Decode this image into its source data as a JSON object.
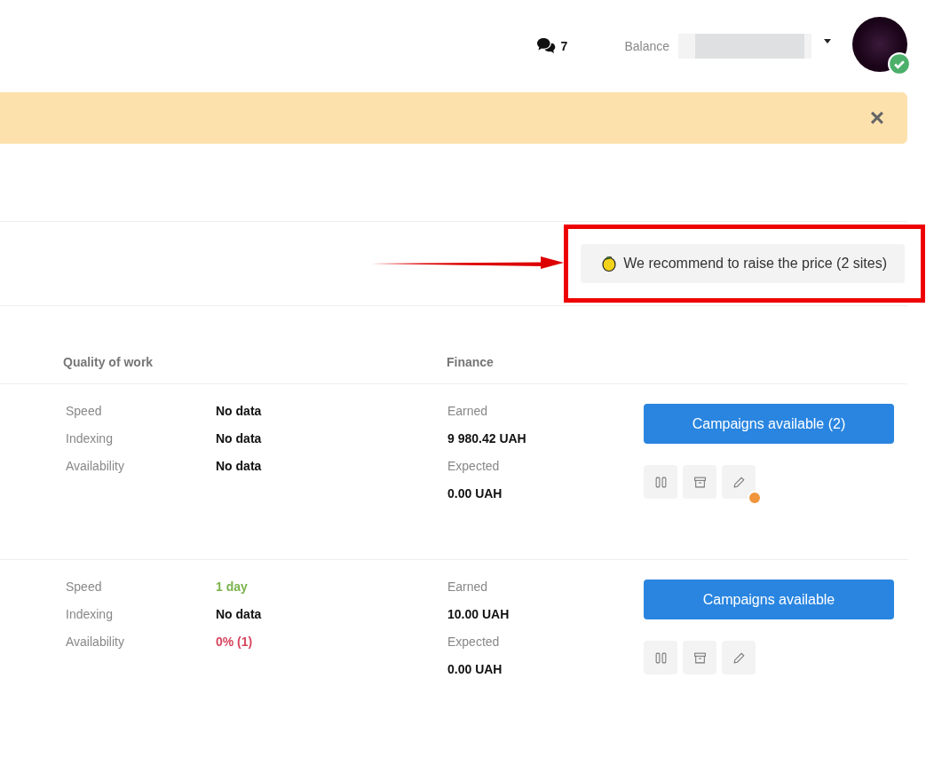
{
  "header": {
    "messages_count": "7",
    "balance_label": "Balance",
    "avatar_verified": true
  },
  "notice": {
    "close": "×"
  },
  "recommendation": {
    "label": "We recommend to raise the price (2 sites)",
    "highlighted": true
  },
  "columns": [
    "Quality of work",
    "Finance"
  ],
  "rows": [
    {
      "quality": [
        {
          "label": "Speed",
          "value": "No data",
          "color": "#111111"
        },
        {
          "label": "Indexing",
          "value": "No data",
          "color": "#111111"
        },
        {
          "label": "Availability",
          "value": "No data",
          "color": "#111111"
        }
      ],
      "earned_label": "Earned",
      "earned": "9 980.42 UAH",
      "expected_label": "Expected",
      "expected": "0.00 UAH",
      "button": "Campaigns available (2)",
      "edit_dot": true
    },
    {
      "quality": [
        {
          "label": "Speed",
          "value": "1 day",
          "color": "#7ab34d"
        },
        {
          "label": "Indexing",
          "value": "No data",
          "color": "#111111"
        },
        {
          "label": "Availability",
          "value": "0%  (1)",
          "color": "#d8455e"
        }
      ],
      "earned_label": "Earned",
      "earned": "10.00 UAH",
      "expected_label": "Expected",
      "expected": "0.00 UAH",
      "button": "Campaigns available",
      "edit_dot": false
    }
  ]
}
